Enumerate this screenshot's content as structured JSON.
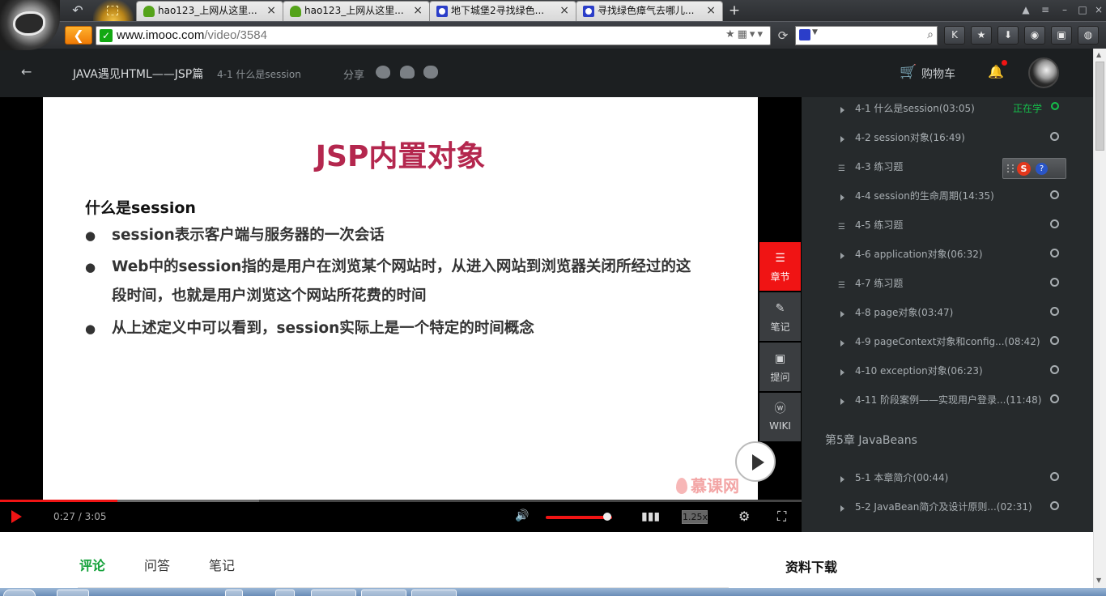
{
  "browser": {
    "tabs": [
      {
        "label": "hao123_上网从这里...",
        "icon": "hao123-icon",
        "active": false
      },
      {
        "label": "hao123_上网从这里...",
        "icon": "hao123-icon",
        "active": false
      },
      {
        "label": "地下城堡2寻找绿色...",
        "icon": "baidu-icon",
        "active": false
      },
      {
        "label": "寻找绿色瘴气去哪儿...",
        "icon": "baidu-icon",
        "active": false
      }
    ],
    "new_tab": "+",
    "url_host": "www.imooc.com",
    "url_path": "/video/3584",
    "accent_color": "#ef7a06"
  },
  "header": {
    "course_title": "JAVA遇见HTML——JSP篇",
    "lesson_title": "4-1 什么是session",
    "share_label": "分享",
    "cart_label": "购物车"
  },
  "slide": {
    "title": "JSP内置对象",
    "question": "什么是session",
    "bullets": [
      {
        "lines": [
          "session表示客户端与服务器的一次会话"
        ]
      },
      {
        "lines": [
          "Web中的session指的是用户在浏览某个网站时，从进入网站到浏览器关闭所经过的这",
          "段时间，也就是用户浏览这个网站所花费的时间"
        ]
      },
      {
        "lines": [
          "从上述定义中可以看到，session实际上是一个特定的时间概念"
        ]
      }
    ],
    "logo_text": "慕课网",
    "title_color": "#b4274e"
  },
  "side_tools": [
    {
      "label": "章节",
      "icon": "menu-icon",
      "active": true
    },
    {
      "label": "笔记",
      "icon": "pencil-icon",
      "active": false
    },
    {
      "label": "提问",
      "icon": "question-bubble-icon",
      "active": false
    },
    {
      "label": "WIKI",
      "icon": "wiki-icon",
      "active": false
    }
  ],
  "player": {
    "time": "0:27 / 3:05",
    "speed": "1.25x",
    "progress": 0.146,
    "buffered": 0.323,
    "volume": 0.93,
    "accent_color": "#f01414"
  },
  "chapters": {
    "current_label": "正在学",
    "lessons": [
      {
        "name": "4-1 什么是session(03:05)",
        "type": "video",
        "current": true
      },
      {
        "name": "4-2 session对象(16:49)",
        "type": "video",
        "current": false
      },
      {
        "name": "4-3 练习题",
        "type": "exercise",
        "current": false
      },
      {
        "name": "4-4 session的生命周期(14:35)",
        "type": "video",
        "current": false
      },
      {
        "name": "4-5 练习题",
        "type": "exercise",
        "current": false
      },
      {
        "name": "4-6 application对象(06:32)",
        "type": "video",
        "current": false
      },
      {
        "name": "4-7 练习题",
        "type": "exercise",
        "current": false
      },
      {
        "name": "4-8 page对象(03:47)",
        "type": "video",
        "current": false
      },
      {
        "name": "4-9 pageContext对象和config...(08:42)",
        "type": "video",
        "current": false
      },
      {
        "name": "4-10 exception对象(06:23)",
        "type": "video",
        "current": false
      },
      {
        "name": "4-11 阶段案例——实现用户登录...(11:48)",
        "type": "video",
        "current": false
      }
    ],
    "chapter5_title": "第5章 JavaBeans",
    "chapter5_lessons": [
      {
        "name": "5-1 本章简介(00:44)",
        "type": "video"
      },
      {
        "name": "5-2 JavaBean简介及设计原则...(02:31)",
        "type": "video"
      }
    ],
    "current_color": "#15c04b"
  },
  "content_tabs": [
    {
      "label": "评论",
      "active": true
    },
    {
      "label": "问答",
      "active": false
    },
    {
      "label": "笔记",
      "active": false
    }
  ],
  "downloads_label": "资料下载"
}
